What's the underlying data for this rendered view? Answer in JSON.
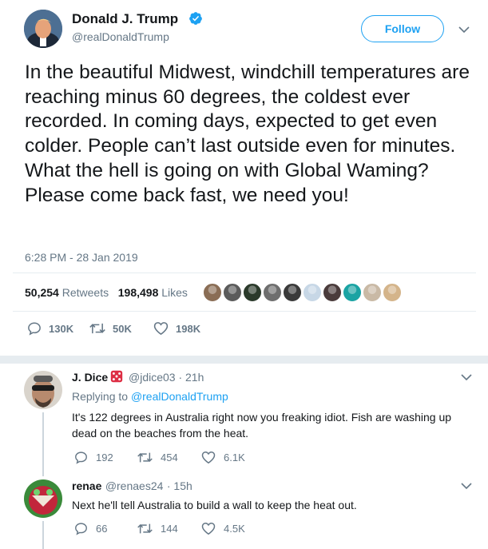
{
  "tweet": {
    "author_name": "Donald J. Trump",
    "author_handle": "@realDonaldTrump",
    "follow_label": "Follow",
    "text": "In the beautiful Midwest, windchill temperatures are reaching minus 60 degrees, the coldest ever recorded. In coming days, expected to get even colder. People can’t last outside even for minutes. What the hell is going on with Global Waming? Please come back fast, we need you!",
    "timestamp": "6:28 PM - 28 Jan 2019",
    "retweets_count": "50,254",
    "retweets_label": "Retweets",
    "likes_count": "198,498",
    "likes_label": "Likes",
    "reply_count": "130K",
    "retweet_count": "50K",
    "like_count": "198K",
    "liker_avatar_colors": [
      "#8a6d55",
      "#5b5b5b",
      "#2b3a2b",
      "#6e6e6e",
      "#3a3a3a",
      "#c7d7e6",
      "#4a3b3b",
      "#1aa3a3",
      "#c9b9a5",
      "#d4b48a"
    ]
  },
  "replies": [
    {
      "name": "J. Dice",
      "handle": "@jdice03",
      "time": "· 21h",
      "replying_prefix": "Replying to",
      "replying_handle": "@realDonaldTrump",
      "text": "It's 122 degrees in Australia right now you freaking idiot. Fish are washing up dead on the beaches from the heat.",
      "reply_count": "192",
      "retweet_count": "454",
      "like_count": "6.1K"
    },
    {
      "name": "renae",
      "handle": "@renaes24",
      "time": "· 15h",
      "text": "Next he'll tell Australia to build a wall to keep the heat out.",
      "reply_count": "66",
      "retweet_count": "144",
      "like_count": "4.5K"
    }
  ],
  "colors": {
    "accent": "#1da1f2",
    "text": "#14171a",
    "muted": "#657786",
    "divider": "#e6ecf0",
    "like_pink": "#e0245e",
    "retweet_green": "#17bf63"
  }
}
